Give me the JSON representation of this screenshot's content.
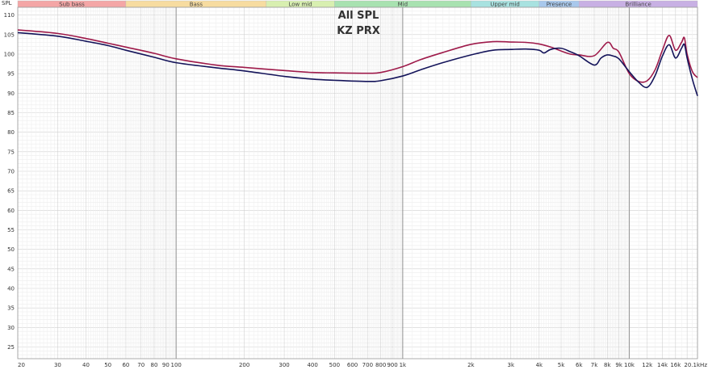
{
  "chart_data": {
    "type": "line",
    "title": "All SPL",
    "subtitle": "KZ PRX",
    "ylabel": "SPL",
    "xlabel": "",
    "xscale": "log",
    "xlim": [
      20,
      20000
    ],
    "ylim": [
      22,
      112
    ],
    "grid": true,
    "y_ticks": [
      110,
      105,
      100,
      95,
      90,
      85,
      80,
      75,
      70,
      65,
      60,
      55,
      50,
      45,
      40,
      35,
      30,
      25
    ],
    "x_ticks": [
      {
        "v": 20,
        "label": "20"
      },
      {
        "v": 30,
        "label": "30"
      },
      {
        "v": 40,
        "label": "40"
      },
      {
        "v": 50,
        "label": "50"
      },
      {
        "v": 60,
        "label": "60"
      },
      {
        "v": 70,
        "label": "70"
      },
      {
        "v": 80,
        "label": "80"
      },
      {
        "v": 90,
        "label": "90"
      },
      {
        "v": 100,
        "label": "100"
      },
      {
        "v": 200,
        "label": "200"
      },
      {
        "v": 300,
        "label": "300"
      },
      {
        "v": 400,
        "label": "400"
      },
      {
        "v": 500,
        "label": "500"
      },
      {
        "v": 600,
        "label": "600"
      },
      {
        "v": 700,
        "label": "700"
      },
      {
        "v": 800,
        "label": "800"
      },
      {
        "v": 900,
        "label": "900"
      },
      {
        "v": 1000,
        "label": "1k"
      },
      {
        "v": 2000,
        "label": "2k"
      },
      {
        "v": 3000,
        "label": "3k"
      },
      {
        "v": 4000,
        "label": "4k"
      },
      {
        "v": 5000,
        "label": "5k"
      },
      {
        "v": 6000,
        "label": "6k"
      },
      {
        "v": 7000,
        "label": "7k"
      },
      {
        "v": 8000,
        "label": "8k"
      },
      {
        "v": 9000,
        "label": "9k"
      },
      {
        "v": 10000,
        "label": "10k"
      },
      {
        "v": 12000,
        "label": "12k"
      },
      {
        "v": 14000,
        "label": "14k"
      },
      {
        "v": 16000,
        "label": "16k"
      },
      {
        "v": 18000,
        "label": ""
      },
      {
        "v": 20000,
        "label": "20.1kHz"
      }
    ],
    "bands": [
      {
        "label": "Sub bass",
        "from": 20,
        "to": 60,
        "color": "#f4a6a6"
      },
      {
        "label": "Bass",
        "from": 60,
        "to": 250,
        "color": "#f7dca0"
      },
      {
        "label": "Low mid",
        "from": 250,
        "to": 500,
        "color": "#d8efb0"
      },
      {
        "label": "Mid",
        "from": 500,
        "to": 2000,
        "color": "#a8e2b0"
      },
      {
        "label": "Upper mid",
        "from": 2000,
        "to": 4000,
        "color": "#a8e2e0"
      },
      {
        "label": "Presence",
        "from": 4000,
        "to": 6000,
        "color": "#a8c8ec"
      },
      {
        "label": "Brilliance",
        "from": 6000,
        "to": 20000,
        "color": "#c8b0e4"
      }
    ],
    "series": [
      {
        "color": "#9e1a4a",
        "x": [
          20,
          30,
          40,
          50,
          60,
          80,
          100,
          150,
          200,
          300,
          400,
          500,
          700,
          800,
          1000,
          1200,
          1500,
          2000,
          2500,
          3000,
          3500,
          4000,
          4500,
          5000,
          5500,
          6000,
          7000,
          8000,
          8500,
          9000,
          10000,
          11000,
          12000,
          13000,
          14000,
          15000,
          16000,
          17000,
          17500,
          18000,
          19000,
          20000
        ],
        "y": [
          106.2,
          105.3,
          104.0,
          102.8,
          101.8,
          100.2,
          98.8,
          97.2,
          96.6,
          95.8,
          95.3,
          95.2,
          95.1,
          95.3,
          96.8,
          98.6,
          100.4,
          102.5,
          103.2,
          103.1,
          103.0,
          102.6,
          101.8,
          100.8,
          100.0,
          99.8,
          99.6,
          103.0,
          101.5,
          100.5,
          95.0,
          93.0,
          93.2,
          96.0,
          101.0,
          104.8,
          101.0,
          103.0,
          104.2,
          100.0,
          95.5,
          94.0
        ]
      },
      {
        "color": "#14145a",
        "x": [
          20,
          30,
          40,
          50,
          60,
          80,
          100,
          150,
          200,
          300,
          400,
          500,
          700,
          800,
          1000,
          1200,
          1500,
          2000,
          2500,
          3000,
          3500,
          4000,
          4200,
          4500,
          5000,
          5500,
          6000,
          7000,
          7500,
          8000,
          8500,
          9000,
          10000,
          11000,
          12000,
          13000,
          14000,
          15000,
          16000,
          17000,
          17500,
          18000,
          19000,
          20000
        ],
        "y": [
          105.5,
          104.6,
          103.3,
          102.2,
          101.0,
          99.2,
          97.8,
          96.5,
          95.7,
          94.3,
          93.6,
          93.3,
          93.0,
          93.2,
          94.4,
          96.0,
          97.8,
          99.8,
          101.0,
          101.2,
          101.3,
          101.0,
          100.3,
          101.2,
          101.5,
          100.6,
          99.6,
          97.2,
          99.0,
          99.8,
          99.5,
          98.8,
          95.5,
          92.8,
          91.5,
          94.5,
          99.5,
          102.4,
          99.0,
          101.5,
          102.5,
          99.0,
          93.5,
          89.3
        ]
      }
    ]
  }
}
